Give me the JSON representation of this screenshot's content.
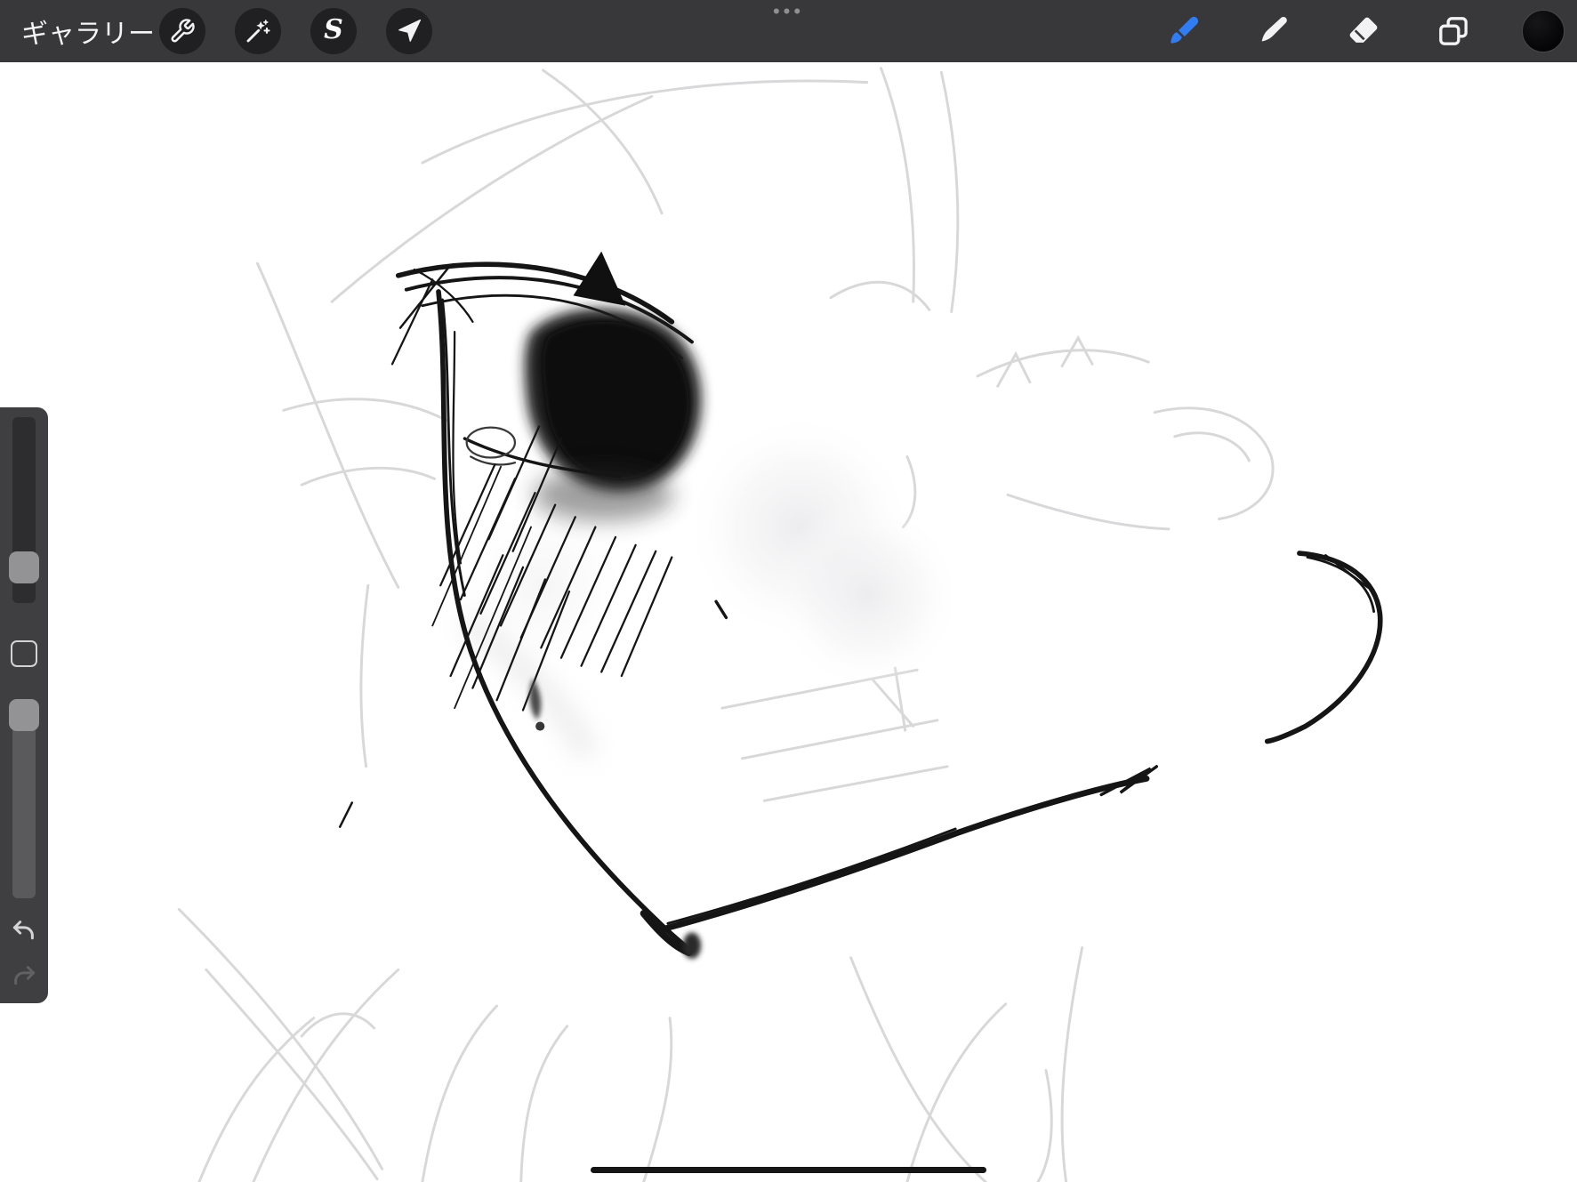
{
  "top_bar": {
    "background": "#38383a",
    "gallery_label": "ギャラリー",
    "drag_handle_dots": "•••",
    "selection_glyph": "S",
    "left_tools": [
      {
        "id": "actions",
        "icon": "wrench-icon"
      },
      {
        "id": "adjustments",
        "icon": "magic-wand-icon"
      },
      {
        "id": "selection",
        "icon": "selection-s-icon"
      },
      {
        "id": "transform",
        "icon": "transform-arrow-icon"
      }
    ],
    "right_tools": [
      {
        "id": "paint",
        "icon": "paintbrush-icon",
        "active": true,
        "accent_color": "#2f7cf3"
      },
      {
        "id": "smudge",
        "icon": "smudge-icon",
        "active": false
      },
      {
        "id": "erase",
        "icon": "eraser-icon",
        "active": false
      },
      {
        "id": "layers",
        "icon": "layers-icon",
        "active": false
      },
      {
        "id": "color",
        "icon": "color-swatch",
        "current_color": "#0a0a0c"
      }
    ]
  },
  "sidebar": {
    "sliders": [
      {
        "id": "brush-size"
      },
      {
        "id": "opacity"
      }
    ],
    "modify_button": {
      "id": "modify"
    },
    "undo_enabled": true,
    "redo_enabled": false
  },
  "canvas": {
    "background": "#ffffff",
    "ink_color": "#151515",
    "guide_color": "#d6d6d8",
    "content": "rough monochrome sketch of an anime-style eye and face"
  },
  "home_indicator": {
    "visible": true
  }
}
